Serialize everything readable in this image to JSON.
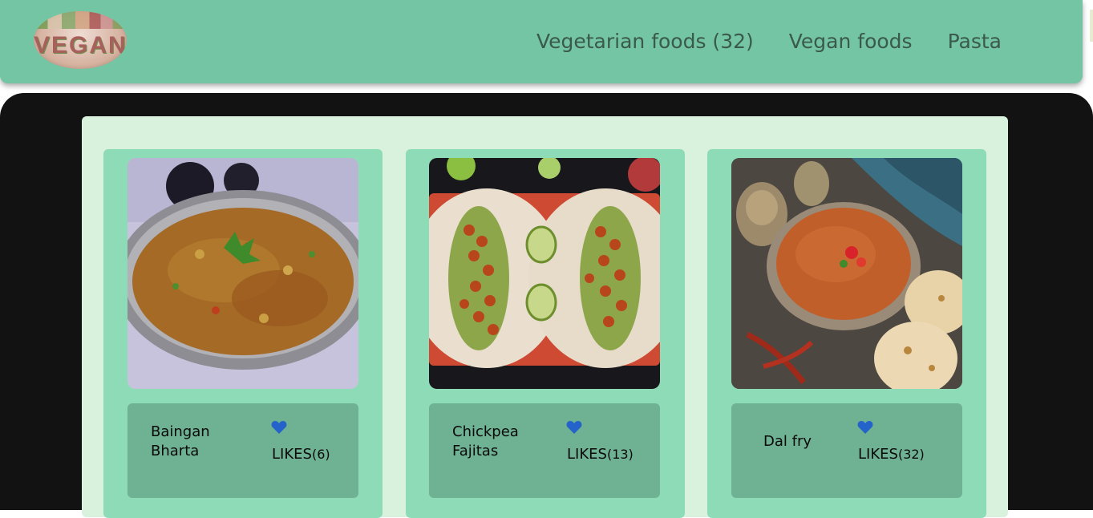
{
  "header": {
    "logo_text": "VEGAN",
    "nav": [
      {
        "label": "Vegetarian foods (32)"
      },
      {
        "label": "Vegan foods"
      },
      {
        "label": "Pasta"
      }
    ]
  },
  "cards": [
    {
      "name": "Baingan Bharta",
      "likes_label": "LIKES",
      "likes_count": "(6)",
      "photo": "baingan-bharta-photo"
    },
    {
      "name": "Chickpea Fajitas",
      "likes_label": "LIKES",
      "likes_count": "(13)",
      "photo": "chickpea-fajitas-photo"
    },
    {
      "name": "Dal fry",
      "likes_label": "LIKES",
      "likes_count": "(32)",
      "photo": "dal-fry-photo"
    }
  ],
  "colors": {
    "header": "#74c5a3",
    "stage": "#121212",
    "panel": "#d8f2dd",
    "card": "#8edcb7",
    "info": "#6fb193",
    "heart": "#2463c9"
  },
  "icons": {
    "like": "heart-icon"
  }
}
